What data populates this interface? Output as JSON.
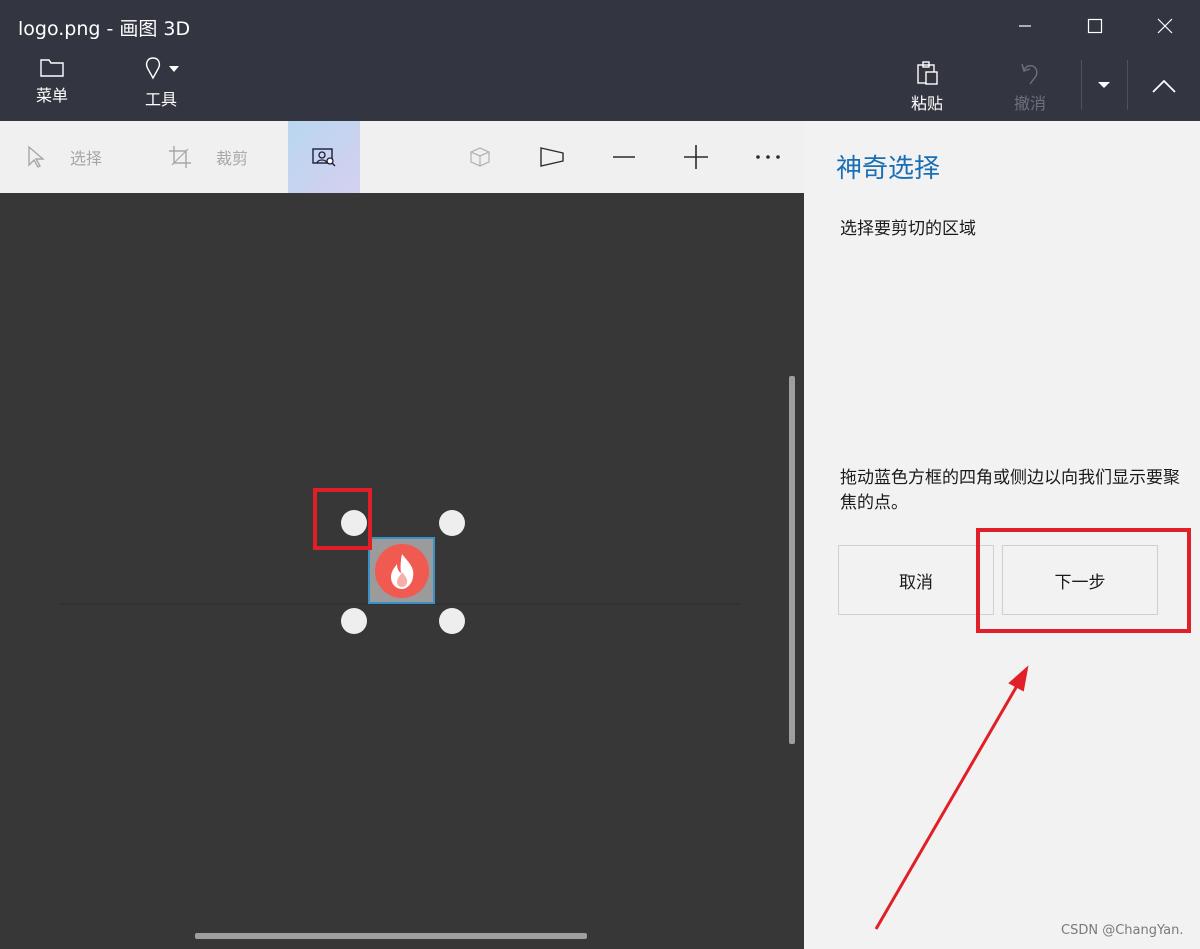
{
  "window": {
    "title": "logo.png - 画图 3D",
    "minimize_icon": "minimize-icon",
    "maximize_icon": "maximize-icon",
    "close_icon": "close-icon"
  },
  "ribbon": {
    "menu_label": "菜单",
    "tools_label": "工具",
    "paste_label": "粘贴",
    "undo_label": "撤消"
  },
  "toolbar": {
    "select_label": "选择",
    "crop_label": "裁剪",
    "active_tool": "magic-select"
  },
  "panel": {
    "title": "神奇选择",
    "subtitle": "选择要剪切的区域",
    "instructions": "拖动蓝色方框的四角或侧边以向我们显示要聚焦的点。",
    "cancel_label": "取消",
    "next_label": "下一步"
  },
  "watermark": "CSDN @ChangYan.",
  "colors": {
    "accent": "#1a6fb4",
    "annotation": "#e11f26",
    "selection_border": "#3a91c9",
    "logo": "#f05a50"
  }
}
